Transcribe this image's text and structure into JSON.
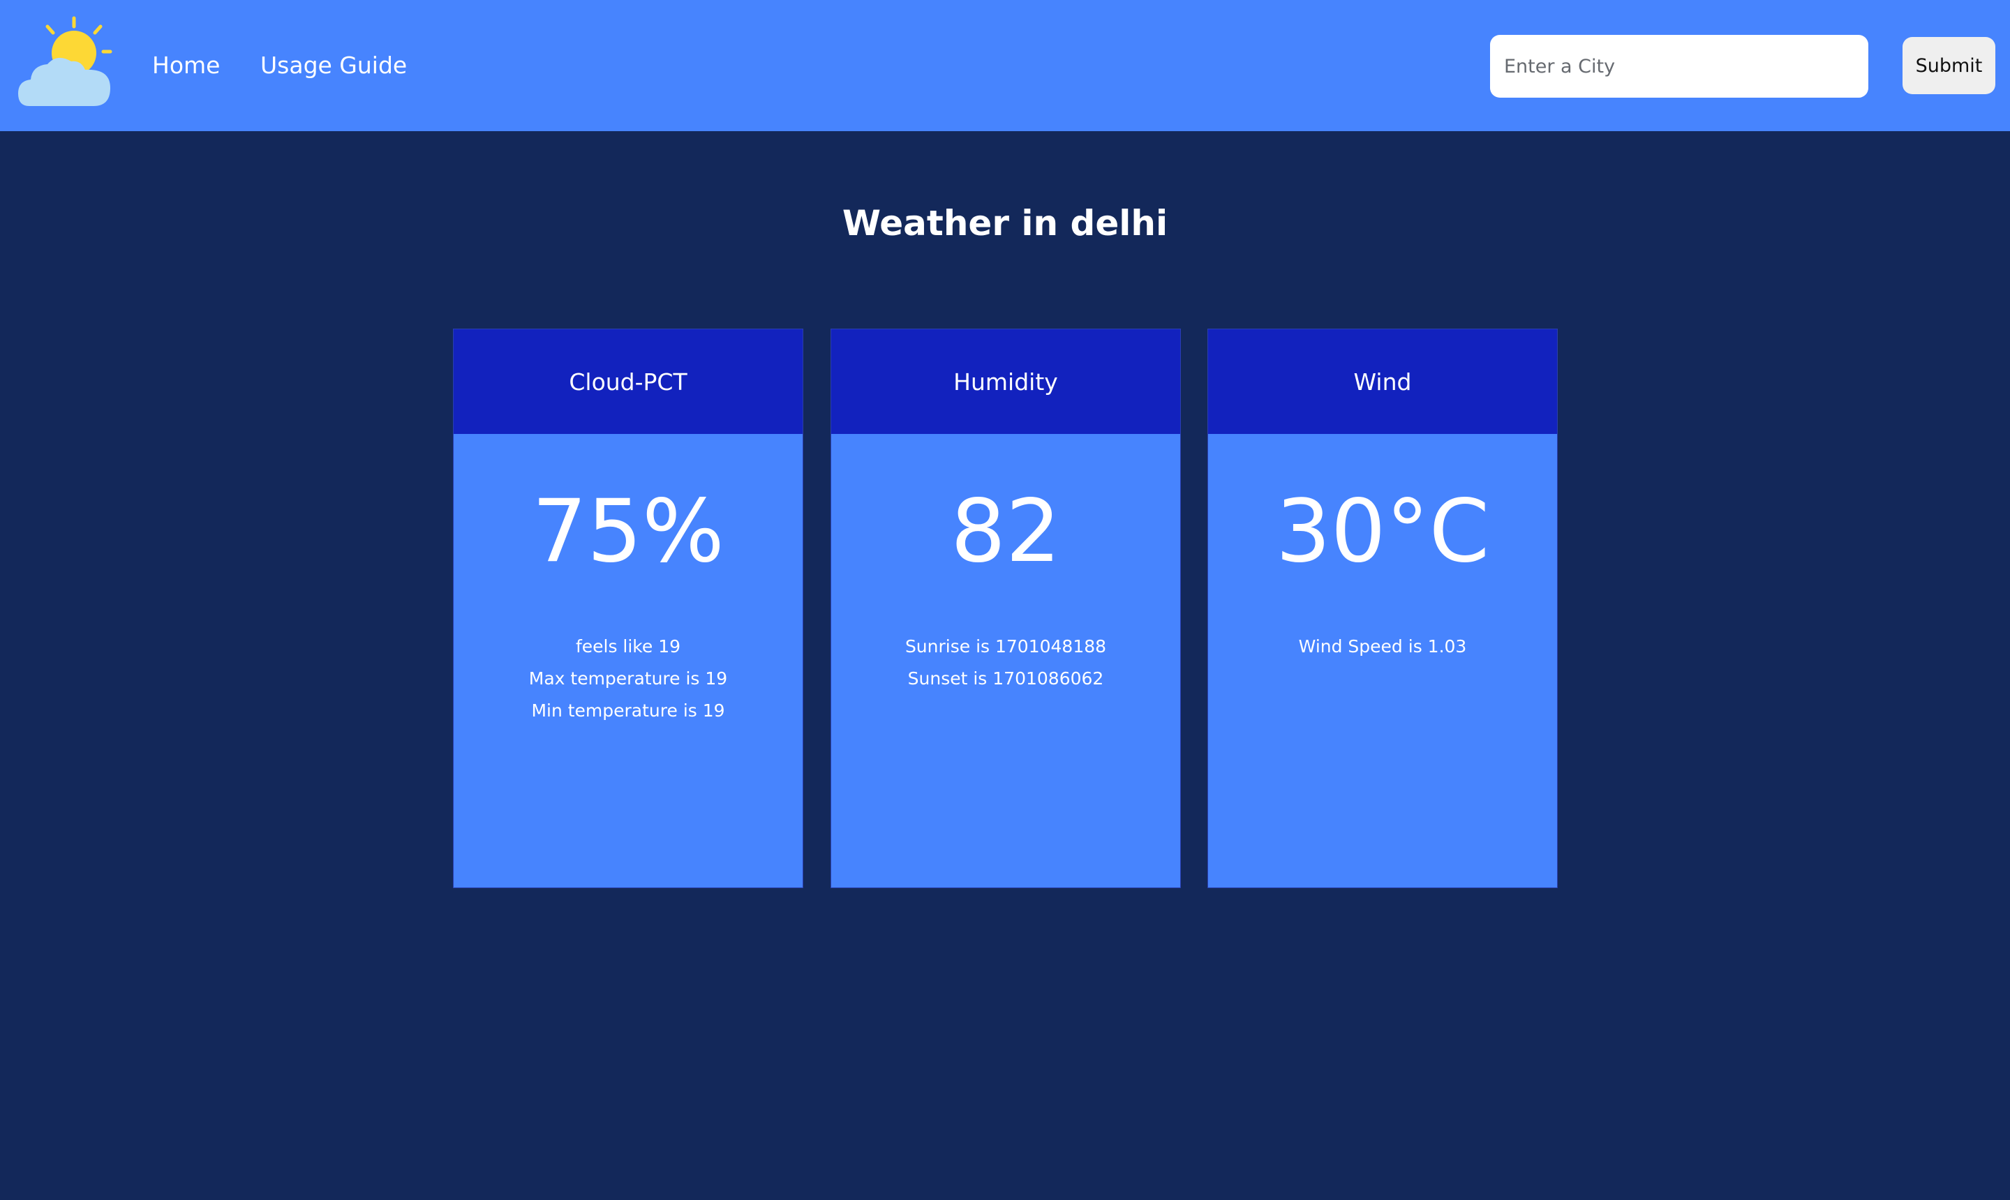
{
  "navbar": {
    "logo_icon": "sun-behind-cloud-icon",
    "links": [
      {
        "label": "Home"
      },
      {
        "label": "Usage Guide"
      }
    ],
    "search": {
      "placeholder": "Enter a City",
      "value": ""
    },
    "submit_label": "Submit"
  },
  "main": {
    "title": "Weather in delhi",
    "cards": [
      {
        "header": "Cloud-PCT",
        "value": "75%",
        "details": [
          "feels like 19",
          "Max temperature is 19",
          "Min temperature is 19"
        ]
      },
      {
        "header": "Humidity",
        "value": "82",
        "details": [
          "Sunrise is 1701048188",
          "Sunset is 1701086062"
        ]
      },
      {
        "header": "Wind",
        "value": "30°C",
        "details": [
          "Wind Speed is 1.03"
        ]
      }
    ]
  },
  "colors": {
    "navbar_bg": "#4784fe",
    "page_bg": "#13285a",
    "card_header_bg": "#1222be",
    "card_body_bg": "#4784fe",
    "sun": "#fdd835",
    "cloud": "#b3dbf7"
  }
}
